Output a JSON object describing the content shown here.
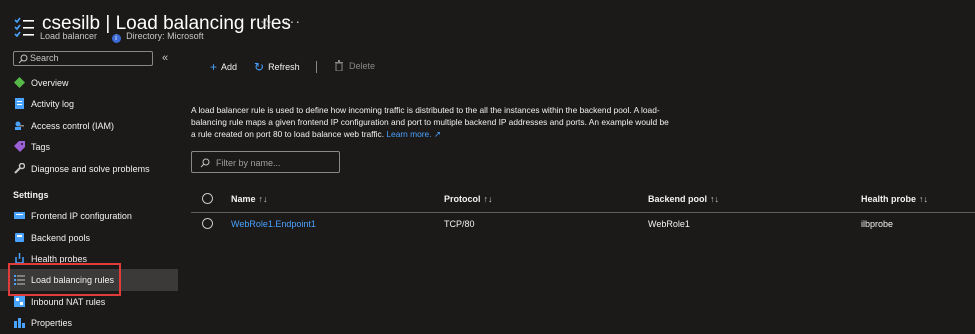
{
  "header": {
    "title": "csesilb | Load balancing rules",
    "resource_type": "Load balancer",
    "directory": "Directory: Microsoft",
    "star": "☆",
    "more": "···"
  },
  "sidebar": {
    "search_placeholder": "Search",
    "collapse": "«",
    "items_top": [
      {
        "label": "Overview",
        "icon": "overview-icon"
      },
      {
        "label": "Activity log",
        "icon": "activity-log-icon"
      },
      {
        "label": "Access control (IAM)",
        "icon": "iam-icon"
      },
      {
        "label": "Tags",
        "icon": "tag-icon"
      },
      {
        "label": "Diagnose and solve problems",
        "icon": "wrench-icon"
      }
    ],
    "settings_heading": "Settings",
    "items_settings": [
      {
        "label": "Frontend IP configuration",
        "icon": "frontend-ip-icon"
      },
      {
        "label": "Backend pools",
        "icon": "backend-pool-icon"
      },
      {
        "label": "Health probes",
        "icon": "health-probe-icon"
      },
      {
        "label": "Load balancing rules",
        "icon": "lb-rules-icon"
      },
      {
        "label": "Inbound NAT rules",
        "icon": "nat-rules-icon"
      },
      {
        "label": "Properties",
        "icon": "properties-icon"
      }
    ]
  },
  "toolbar": {
    "add": "Add",
    "refresh": "Refresh",
    "delete": "Delete"
  },
  "description": {
    "text": "A load balancer rule is used to define how incoming traffic is distributed to the all the instances within the backend pool. A load-balancing rule maps a given frontend IP configuration and port to multiple backend IP addresses and ports. An example would be a rule created on port 80 to load balance web traffic.",
    "learn_more": "Learn more."
  },
  "filter": {
    "placeholder": "Filter by name..."
  },
  "table": {
    "columns": [
      "Name",
      "Protocol",
      "Backend pool",
      "Health probe"
    ],
    "sort_glyph": "↑↓",
    "rows": [
      {
        "name": "WebRole1.Endpoint1",
        "protocol": "TCP/80",
        "backend_pool": "WebRole1",
        "health_probe": "ilbprobe"
      }
    ]
  },
  "colors": {
    "accent": "#4aa2ff",
    "background": "#1b1a19",
    "selection_highlight": "#e03c3c"
  }
}
